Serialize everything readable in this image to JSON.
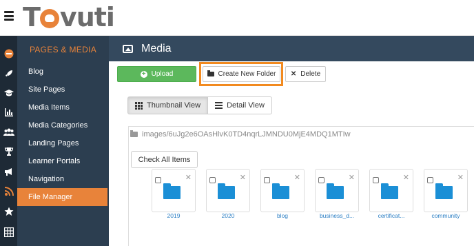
{
  "header": {
    "logo_pre": "T",
    "logo_post": "vuti"
  },
  "sidebar": {
    "heading": "PAGES & MEDIA",
    "items": [
      {
        "label": "Blog"
      },
      {
        "label": "Site Pages"
      },
      {
        "label": "Media Items"
      },
      {
        "label": "Media Categories"
      },
      {
        "label": "Landing Pages"
      },
      {
        "label": "Learner Portals"
      },
      {
        "label": "Navigation"
      },
      {
        "label": "File Manager",
        "active": true
      }
    ]
  },
  "rail": {
    "icons": [
      "home-badge-icon",
      "rocket-icon",
      "graduation-cap-icon",
      "bar-chart-icon",
      "users-icon",
      "trophy-icon",
      "megaphone-icon",
      "rss-icon",
      "star-icon",
      "table-icon"
    ]
  },
  "main": {
    "title": "Media",
    "toolbar": {
      "upload_label": "Upload",
      "new_folder_label": "Create New Folder",
      "delete_label": "Delete"
    },
    "views": {
      "thumbnail_label": "Thumbnail View",
      "detail_label": "Detail View",
      "active": "thumbnail"
    },
    "path": "images/6uJg2e6OAsHlvK0TD4nqrLJMNDU0MjE4MDQ1MTIw",
    "check_all_label": "Check All Items",
    "folders": [
      {
        "name": "2019"
      },
      {
        "name": "2020"
      },
      {
        "name": "blog"
      },
      {
        "name": "business_d..."
      },
      {
        "name": "certificat..."
      },
      {
        "name": "community"
      }
    ]
  },
  "colors": {
    "accent": "#e8833a",
    "sidebar_bg": "#2c3e50",
    "rail_bg": "#1e2a36",
    "header_bar": "#34495e",
    "upload_green": "#5cb85c",
    "folder_blue": "#1b8fd6",
    "highlight": "#f28a1f"
  }
}
